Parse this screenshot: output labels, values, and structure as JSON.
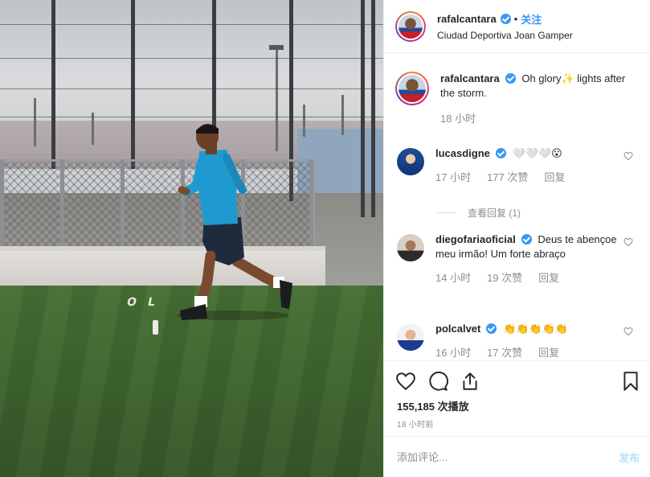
{
  "header": {
    "username": "rafalcantara",
    "separator": "•",
    "follow_label": "关注",
    "location": "Ciudad Deportiva Joan Gamper"
  },
  "video": {
    "ground_text": "OL"
  },
  "caption": {
    "username": "rafalcantara",
    "text": "Oh glory✨ lights after the storm.",
    "time": "18 小时"
  },
  "comments": [
    {
      "username": "lucasdigne",
      "text": "🤍🤍🤍😮",
      "time": "17 小时",
      "likes": "177 次赞",
      "reply_label": "回复",
      "view_replies": "查看回复 (1)"
    },
    {
      "username": "diegofariaoficial",
      "text": "Deus te abençoe meu irmão! Um forte abraço",
      "time": "14 小时",
      "likes": "19 次赞",
      "reply_label": "回复"
    },
    {
      "username": "polcalvet",
      "text": "👏👏👏👏👏",
      "time": "16 小时",
      "likes": "17 次赞",
      "reply_label": "回复"
    }
  ],
  "stats": {
    "views": "155,185 次播放",
    "posted": "18 小时前"
  },
  "composer": {
    "placeholder": "添加评论...",
    "post_label": "发布"
  },
  "colors": {
    "accent": "#3897f0",
    "muted": "#8e8e8e",
    "post_disabled": "#b2dffc"
  },
  "icons": [
    "verified-badge-icon",
    "heart-icon",
    "comment-icon",
    "share-icon",
    "bookmark-icon"
  ]
}
